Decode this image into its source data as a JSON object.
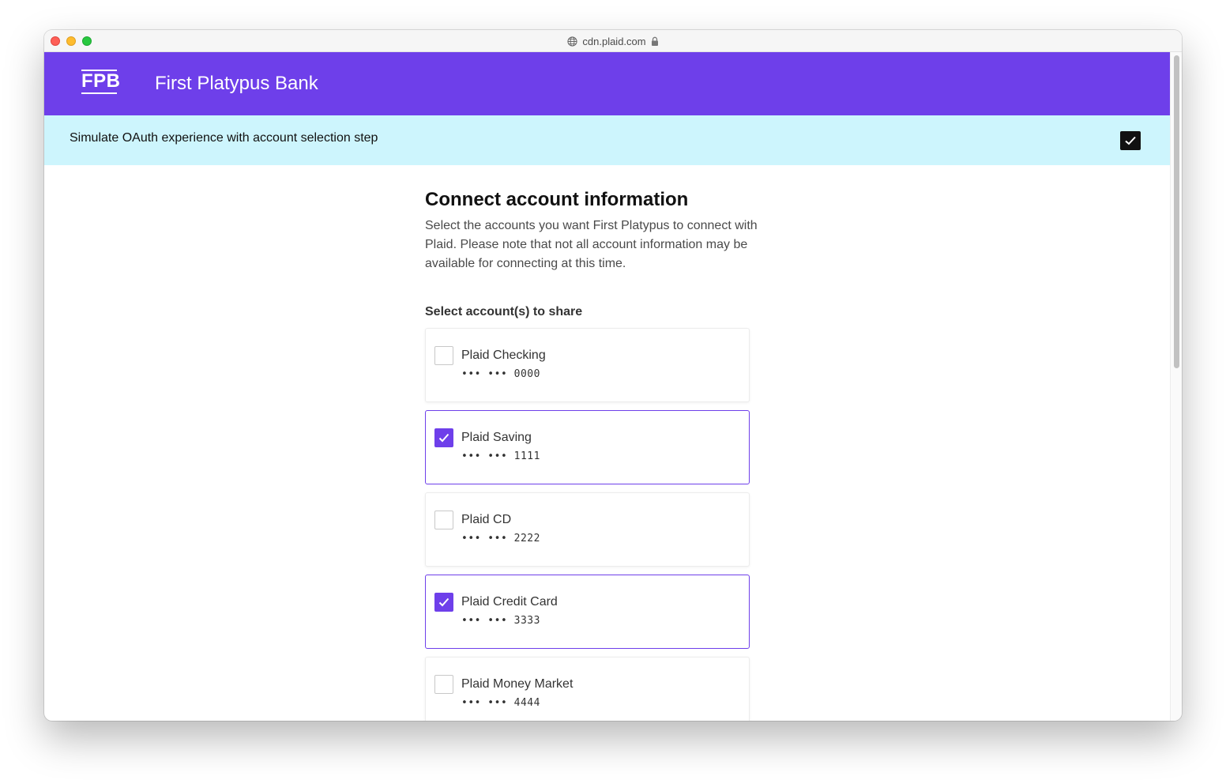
{
  "browser": {
    "url": "cdn.plaid.com"
  },
  "header": {
    "logo": "FPB",
    "bank_name": "First Platypus Bank"
  },
  "simulate": {
    "label": "Simulate OAuth experience with account selection step",
    "checked": true
  },
  "main": {
    "title": "Connect account information",
    "description": "Select the accounts you want First Platypus to connect with Plaid. Please note that not all account information may be available for connecting at this time.",
    "select_label": "Select account(s) to share",
    "accounts": [
      {
        "name": "Plaid Checking",
        "mask": "••• ••• 0000",
        "selected": false
      },
      {
        "name": "Plaid Saving",
        "mask": "••• ••• 1111",
        "selected": true
      },
      {
        "name": "Plaid CD",
        "mask": "••• ••• 2222",
        "selected": false
      },
      {
        "name": "Plaid Credit Card",
        "mask": "••• ••• 3333",
        "selected": true
      },
      {
        "name": "Plaid Money Market",
        "mask": "••• ••• 4444",
        "selected": false
      }
    ]
  },
  "colors": {
    "brand": "#6e3fea",
    "banner": "#cdf5fd"
  }
}
